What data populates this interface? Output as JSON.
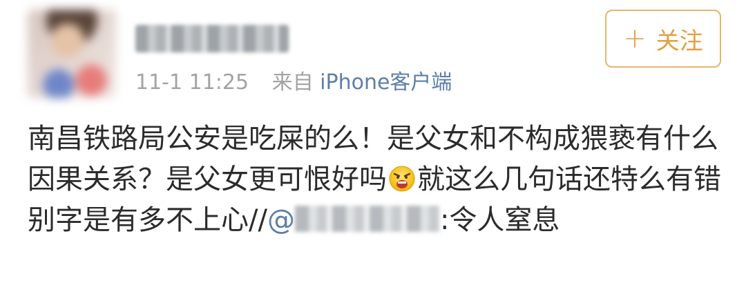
{
  "post": {
    "timestamp": "11-1 11:25",
    "source_prefix": "来自",
    "source_client": "iPhone客户端",
    "follow_plus": "+",
    "follow_label": "关注",
    "text_part1": "南昌铁路局公安是吃屎的么！是父女和不构成猥亵有什么因果关系？是父女更可恨好吗",
    "emoji": "angry-face-emoji",
    "text_part2": "就这么几句话还特么有错别字是有多不上心//",
    "mention_at": "@",
    "text_part3": ":令人窒息"
  },
  "colors": {
    "link_blue": "#5d7ea8",
    "follow_orange": "#e3a042",
    "meta_gray": "#a3a3a3",
    "text": "#2b2b2b"
  }
}
